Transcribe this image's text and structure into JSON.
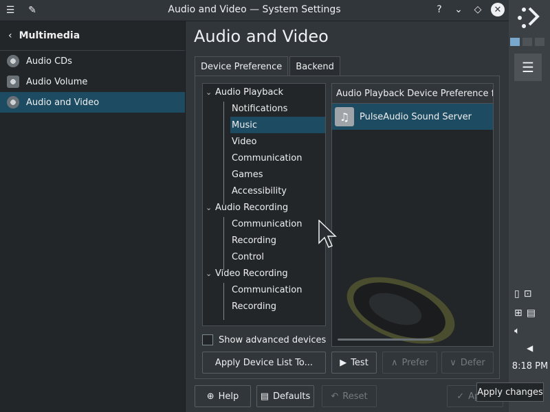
{
  "window": {
    "title": "Audio and Video — System Settings"
  },
  "sidebar": {
    "back_label": "Multimedia",
    "items": [
      {
        "label": "Audio CDs"
      },
      {
        "label": "Audio Volume"
      },
      {
        "label": "Audio and Video"
      }
    ]
  },
  "main": {
    "page_title": "Audio and Video",
    "tabs": [
      {
        "label": "Device Preference"
      },
      {
        "label": "Backend"
      }
    ],
    "tree": {
      "playback": "Audio Playback",
      "playback_items": [
        "Notifications",
        "Music",
        "Video",
        "Communication",
        "Games",
        "Accessibility"
      ],
      "recording": "Audio Recording",
      "recording_items": [
        "Communication",
        "Recording",
        "Control"
      ],
      "video_recording": "Video Recording",
      "video_items": [
        "Communication",
        "Recording"
      ]
    },
    "device_list": {
      "header": "Audio Playback Device Preference for",
      "devices": [
        "PulseAudio Sound Server"
      ]
    },
    "show_advanced": "Show advanced devices",
    "apply_device_list": "Apply Device List To...",
    "test": "Test",
    "prefer": "Prefer",
    "defer": "Defer"
  },
  "footer": {
    "help": "Help",
    "defaults": "Defaults",
    "reset": "Reset",
    "apply": "Apply"
  },
  "panel": {
    "clock": "8:18 PM",
    "tooltip": "Apply changes"
  },
  "colors": {
    "accent": "#1d4b62",
    "bg": "#31363b"
  }
}
